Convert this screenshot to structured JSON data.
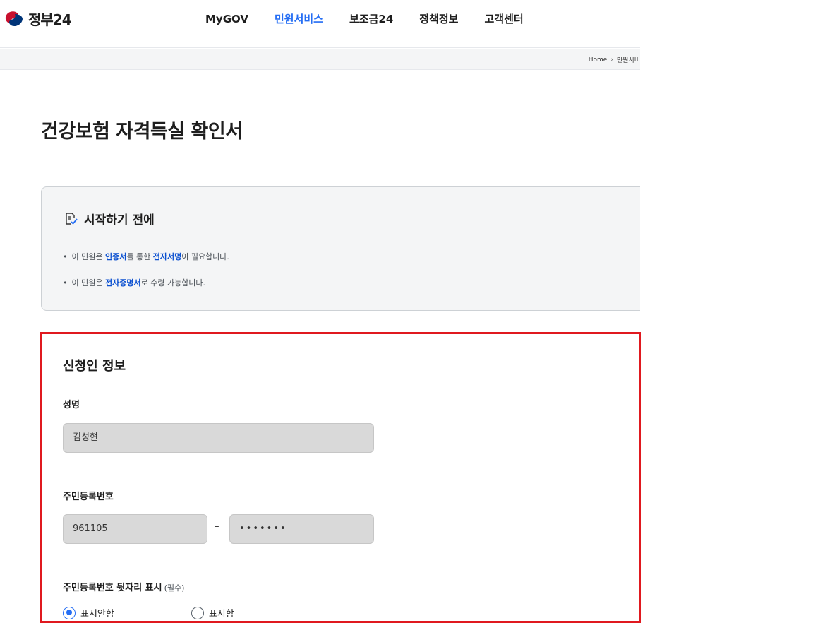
{
  "header": {
    "logo_text": "정부24",
    "nav": [
      "MyGOV",
      "민원서비스",
      "보조금24",
      "정책정보",
      "고객센터"
    ],
    "active_nav": "민원서비스"
  },
  "breadcrumb": {
    "home": "Home",
    "current": "민원서비"
  },
  "page_title": "건강보험 자격득실 확인서",
  "notice": {
    "title": "시작하기 전에",
    "item1": {
      "pre": "이 민원은 ",
      "em1": "인증서",
      "mid": "를 통한 ",
      "em2": "전자서명",
      "post": "이 필요합니다."
    },
    "item2": {
      "pre": "이 민원은 ",
      "em1": "전자증명서",
      "post": "로 수령 가능합니다."
    }
  },
  "applicant": {
    "section_title": "신청인 정보",
    "name_label": "성명",
    "name_value": "김성현",
    "rrn_label": "주민등록번호",
    "rrn_front": "961105",
    "rrn_dash": "–",
    "rrn_back": "•••••••",
    "rrn_display_label": "주민등록번호 뒷자리 표시",
    "required_text": "(필수)",
    "options": [
      "표시안함",
      "표시함"
    ],
    "selected_option": "표시안함"
  },
  "colors": {
    "accent": "#256ef4",
    "highlight_border": "#e0191f",
    "emphasis_text": "#0b50d0"
  },
  "icons": {
    "logo": "government-emblem-icon",
    "notice": "checklist-icon",
    "breadcrumb_separator": "chevron-right-icon"
  }
}
